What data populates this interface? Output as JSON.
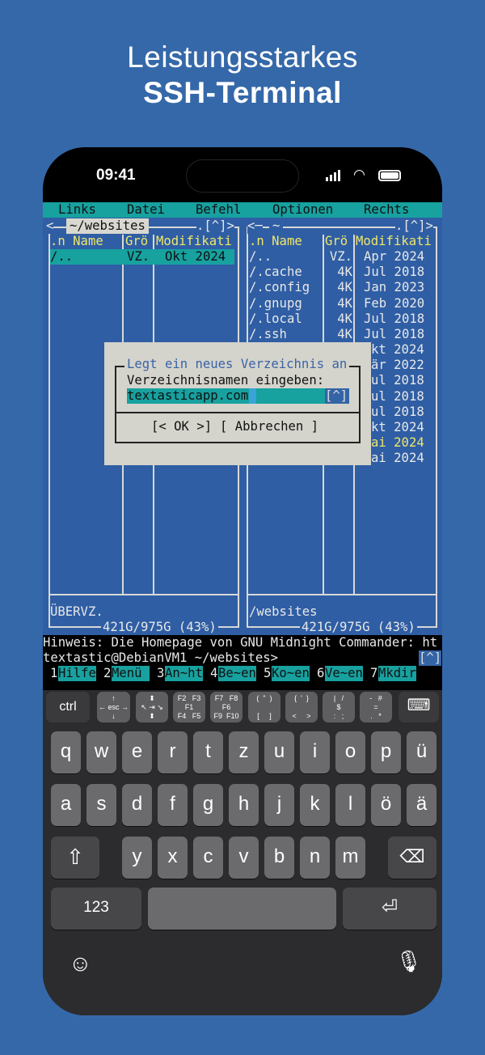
{
  "headline": {
    "line1": "Leistungsstarkes",
    "line2": "SSH-Terminal"
  },
  "status_bar": {
    "time": "09:41"
  },
  "menu": [
    "Links",
    "Datei",
    "Befehl",
    "Optionen",
    "Rechts"
  ],
  "left_panel": {
    "title": "~/websites",
    "corner": ".[^]>",
    "left_corner": "<",
    "headers": [
      ".n Name",
      "Grö",
      "Modifikati"
    ],
    "rows": [
      {
        "name": "/..",
        "size": "VZ.",
        "date": "Okt 2024"
      }
    ],
    "footer": "ÜBERVZ.",
    "stats": "421G/975G (43%)"
  },
  "right_panel": {
    "title": "~",
    "corner": ".[^]>",
    "left_corner": "<─",
    "headers": [
      ".n Name",
      "Grö",
      "Modifikati"
    ],
    "rows": [
      {
        "name": "/..",
        "size": "VZ.",
        "date": "Apr 2024"
      },
      {
        "name": "/.cache",
        "size": "4K",
        "date": "Jul 2018"
      },
      {
        "name": "/.config",
        "size": "4K",
        "date": "Jan 2023"
      },
      {
        "name": "/.gnupg",
        "size": "4K",
        "date": "Feb 2020"
      },
      {
        "name": "/.local",
        "size": "4K",
        "date": "Jul 2018"
      },
      {
        "name": "/.ssh",
        "size": "4K",
        "date": "Jul 2018"
      }
    ],
    "partial_dates": [
      "kt 2024",
      "är 2022",
      "ul 2018",
      "ul 2018",
      "ul 2018",
      "kt 2024",
      "ai 2024",
      "ai 2024"
    ],
    "footer": "/websites",
    "stats": "421G/975G (43%)"
  },
  "dialog": {
    "title": "Legt ein neues Verzeichnis an",
    "label": "Verzeichnisnamen eingeben:",
    "input_value": "textasticapp.com",
    "history": "[^]",
    "ok_label": "[< OK >]",
    "cancel_label": "[ Abbrechen ]"
  },
  "hint": "Hinweis: Die Homepage von GNU Midnight Commander: ht",
  "prompt": "textastic@DebianVM1 ~/websites>",
  "prompt_history": "[^]",
  "fkeys": [
    {
      "n": "1",
      "l": "Hilfe"
    },
    {
      "n": "2",
      "l": "Menü "
    },
    {
      "n": "3",
      "l": "An~ht"
    },
    {
      "n": "4",
      "l": "Be~en"
    },
    {
      "n": "5",
      "l": "Ko~en"
    },
    {
      "n": "6",
      "l": "Ve~en"
    },
    {
      "n": "7",
      "l": "Mkdir"
    }
  ],
  "toolbar": {
    "ctrl": "ctrl",
    "esc": "↑\n← esc →\n↓",
    "tab": "⬍\n↖ ⇥ ↘\n⬍",
    "f1": "F2   F3\nF1\nF4   F5",
    "f6": "F7   F8\nF6\nF9  F10",
    "paren": "(  \"  )\n\n[     ]",
    "brace": "{  '  }\n\n<     >",
    "dollar": "|   /\n$\n:   ;",
    "equals": "-   #\n=\n.   *"
  },
  "keyboard": {
    "row1": [
      "q",
      "w",
      "e",
      "r",
      "t",
      "z",
      "u",
      "i",
      "o",
      "p",
      "ü"
    ],
    "row2": [
      "a",
      "s",
      "d",
      "f",
      "g",
      "h",
      "j",
      "k",
      "l",
      "ö",
      "ä"
    ],
    "row3": [
      "y",
      "x",
      "c",
      "v",
      "b",
      "n",
      "m"
    ],
    "numbers": "123"
  }
}
